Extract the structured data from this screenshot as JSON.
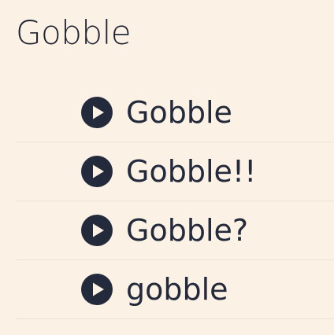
{
  "page": {
    "title": "Gobble"
  },
  "sounds": [
    {
      "label": "Gobble",
      "icon": "play-circle-icon"
    },
    {
      "label": "Gobble!!",
      "icon": "play-circle-icon"
    },
    {
      "label": "Gobble?",
      "icon": "play-circle-icon"
    },
    {
      "label": "gobble",
      "icon": "play-circle-icon"
    }
  ],
  "colors": {
    "background": "#fbf1e4",
    "text": "#232a3c",
    "icon": "#232a3c",
    "divider": "#ece2d4"
  }
}
